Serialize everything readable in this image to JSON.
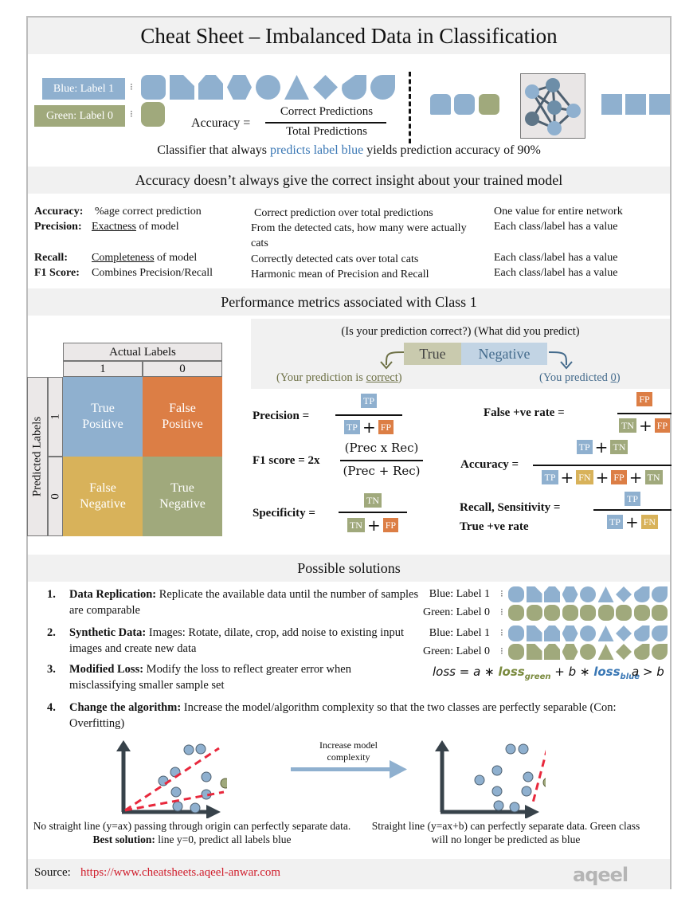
{
  "title": "Cheat Sheet – Imbalanced Data in Classification",
  "intro": {
    "blue_label": "Blue: Label 1",
    "green_label": "Green: Label 0",
    "accuracy_lhs": "Accuracy =",
    "accuracy_num": "Correct Predictions",
    "accuracy_den": "Total Predictions",
    "caption_pre": "Classifier that always ",
    "caption_highlight": "predicts label blue",
    "caption_post": " yields prediction accuracy of 90%",
    "blue_shapes": [
      "rounded-square",
      "cut-corner-square",
      "pentagon",
      "hexagon",
      "circle",
      "triangle",
      "diamond",
      "half-circle",
      "teardrop"
    ],
    "green_shapes": [
      "rounded-square"
    ],
    "classifier_input": [
      "blue",
      "blue",
      "green"
    ],
    "classifier_output": [
      "blue",
      "blue",
      "blue"
    ],
    "classifier_icon": "neural-network-icon"
  },
  "section2": {
    "heading": "Accuracy doesn’t always give the correct insight about your trained model",
    "rows": [
      {
        "name": "Accuracy:",
        "def_pre": "%age correct prediction",
        "def_u": "",
        "def_post": "",
        "desc": "Correct prediction over total predictions",
        "scope": "One value for entire network"
      },
      {
        "name": "Precision:",
        "def_pre": "",
        "def_u": "Exactness",
        "def_post": " of model",
        "desc": "From the detected cats, how many were actually cats",
        "scope": "Each class/label has a value"
      },
      {
        "name": "Recall:",
        "def_pre": "",
        "def_u": "Completeness",
        "def_post": " of model",
        "desc": "Correctly detected cats over total cats",
        "scope": "Each class/label has a value"
      },
      {
        "name": "F1 Score:",
        "def_pre": "Combines Precision/Recall",
        "def_u": "",
        "def_post": "",
        "desc": "Harmonic mean of Precision and Recall",
        "scope": "Each class/label has a value"
      }
    ]
  },
  "section3": {
    "heading": "Performance metrics associated with Class 1",
    "matrix": {
      "actual_header": "Actual Labels",
      "predicted_header": "Predicted Labels",
      "actual_values": [
        "1",
        "0"
      ],
      "predicted_values": [
        "1",
        "0"
      ],
      "cells": [
        {
          "line1": "True",
          "line2": "Positive",
          "color": "#8fb0cf"
        },
        {
          "line1": "False",
          "line2": "Positive",
          "color": "#dc7e45"
        },
        {
          "line1": "False",
          "line2": "Negative",
          "color": "#d8b25a"
        },
        {
          "line1": "True",
          "line2": "Negative",
          "color": "#a0a97c"
        }
      ]
    },
    "legend": {
      "q1": "(Is your prediction correct?)",
      "q2": "(What did you predict)",
      "word1": "True",
      "word2": "Negative",
      "a1_pre": "(Your prediction is ",
      "a1_u": "correct",
      "a1_post": ")",
      "a2_pre": "(You predicted ",
      "a2_u": "0",
      "a2_post": ")"
    },
    "formulas": {
      "precision": {
        "lhs": "Precision =",
        "num": [
          "TP"
        ],
        "den": [
          "TP",
          "FP"
        ]
      },
      "fpr": {
        "lhs": "False +ve rate =",
        "num": [
          "FP"
        ],
        "den": [
          "TN",
          "FP"
        ]
      },
      "f1": {
        "lhs": "F1 score = 2x",
        "num": "(Prec x Rec)",
        "den": "(Prec + Rec)"
      },
      "accuracy": {
        "lhs": "Accuracy =",
        "num": [
          "TP",
          "TN"
        ],
        "den": [
          "TP",
          "FN",
          "FP",
          "TN"
        ]
      },
      "specificity": {
        "lhs": "Specificity =",
        "num": [
          "TN"
        ],
        "den": [
          "TN",
          "FP"
        ]
      },
      "recall": {
        "lhs": "Recall, Sensitivity =",
        "lhs2": "True +ve rate",
        "num": [
          "TP"
        ],
        "den": [
          "TP",
          "FN"
        ]
      }
    },
    "plus": "+"
  },
  "section4": {
    "heading": "Possible solutions",
    "items": [
      {
        "num": "1.",
        "title": "Data Replication:",
        "text": " Replicate the available data until the number of samples are comparable"
      },
      {
        "num": "2.",
        "title": "Synthetic Data:",
        "text": " Images: Rotate, dilate, crop, add noise to existing input images and create new data"
      },
      {
        "num": "3.",
        "title": "Modified Loss:",
        "text": " Modify the loss to reflect greater error when misclassifying smaller sample set"
      },
      {
        "num": "4.",
        "title": "Change the algorithm:",
        "text": " Increase the model/algorithm complexity so that the two classes are perfectly separable (Con: Overfitting)"
      }
    ],
    "rep_labels": [
      "Blue: Label 1",
      "Green: Label 0",
      "Blue: Label 1",
      "Green: Label 0"
    ],
    "loss": {
      "lhs": "loss = ",
      "a": "a ∗ ",
      "green": "loss",
      "green_sub": "green",
      "plus_b": " + b ∗ ",
      "blue": "loss",
      "blue_sub": "blue",
      "cond": "a > b"
    },
    "arrow_label": "Increase model complexity",
    "left_caption_pre": "No straight line (y=ax) passing through origin can perfectly separate data. ",
    "left_caption_bold": "Best solution:",
    "left_caption_post": " line y=0, predict all labels blue",
    "right_caption": "Straight line (y=ax+b) can perfectly separate data. Green class will no longer be predicted as blue"
  },
  "footer": {
    "source_label": "Source: ",
    "source_url": "https://www.cheatsheets.aqeel-anwar.com",
    "logo_text": "aqeel"
  },
  "colors": {
    "blue": "#8fb0cf",
    "green": "#a0a97c",
    "orange": "#dc7e45",
    "yellow": "#d8b25a",
    "link_blue": "#3b78b5",
    "link_red": "#d0202e",
    "dashed_red": "#e8283c",
    "axis": "#37424a"
  }
}
